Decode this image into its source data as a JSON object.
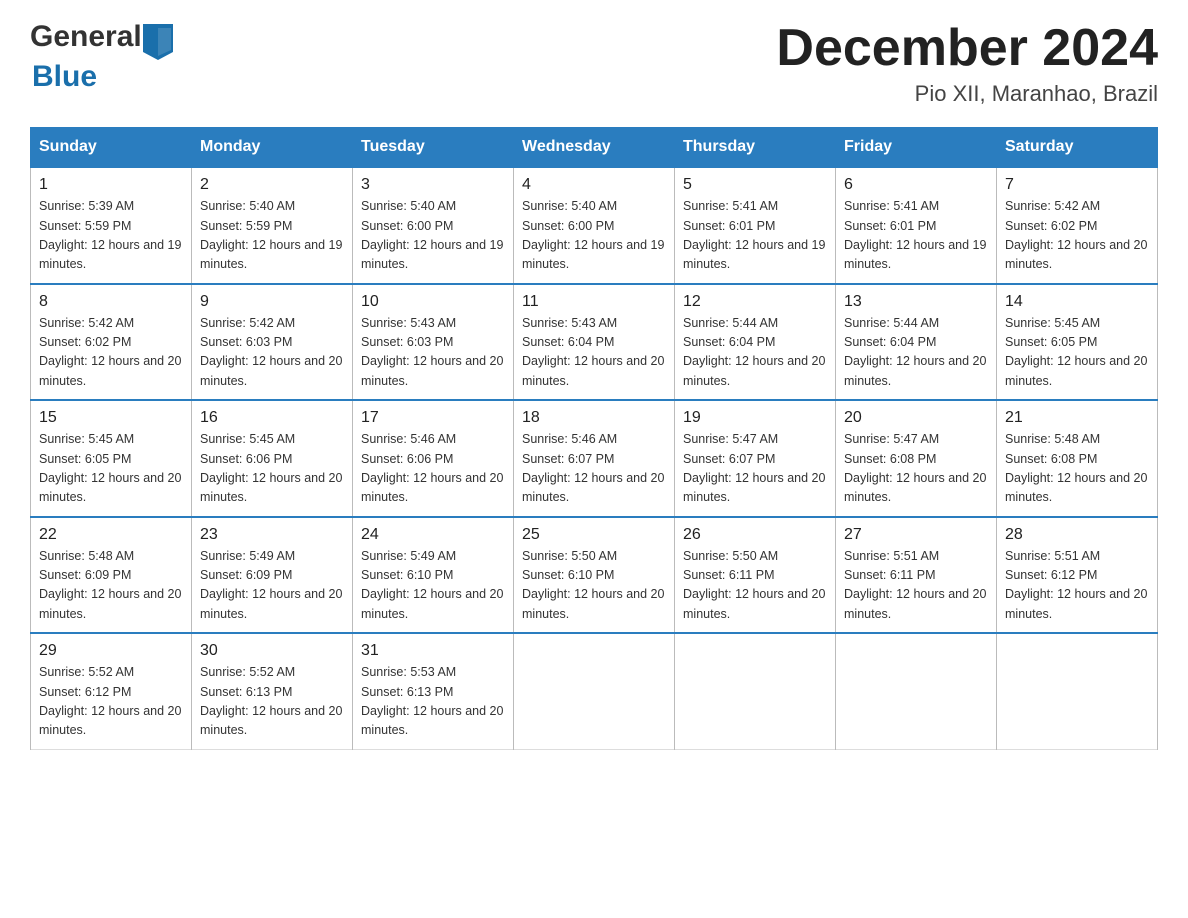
{
  "logo": {
    "general": "General",
    "blue": "Blue"
  },
  "title": "December 2024",
  "location": "Pio XII, Maranhao, Brazil",
  "headers": [
    "Sunday",
    "Monday",
    "Tuesday",
    "Wednesday",
    "Thursday",
    "Friday",
    "Saturday"
  ],
  "weeks": [
    [
      {
        "day": "1",
        "sunrise": "5:39 AM",
        "sunset": "5:59 PM",
        "daylight": "12 hours and 19 minutes."
      },
      {
        "day": "2",
        "sunrise": "5:40 AM",
        "sunset": "5:59 PM",
        "daylight": "12 hours and 19 minutes."
      },
      {
        "day": "3",
        "sunrise": "5:40 AM",
        "sunset": "6:00 PM",
        "daylight": "12 hours and 19 minutes."
      },
      {
        "day": "4",
        "sunrise": "5:40 AM",
        "sunset": "6:00 PM",
        "daylight": "12 hours and 19 minutes."
      },
      {
        "day": "5",
        "sunrise": "5:41 AM",
        "sunset": "6:01 PM",
        "daylight": "12 hours and 19 minutes."
      },
      {
        "day": "6",
        "sunrise": "5:41 AM",
        "sunset": "6:01 PM",
        "daylight": "12 hours and 19 minutes."
      },
      {
        "day": "7",
        "sunrise": "5:42 AM",
        "sunset": "6:02 PM",
        "daylight": "12 hours and 20 minutes."
      }
    ],
    [
      {
        "day": "8",
        "sunrise": "5:42 AM",
        "sunset": "6:02 PM",
        "daylight": "12 hours and 20 minutes."
      },
      {
        "day": "9",
        "sunrise": "5:42 AM",
        "sunset": "6:03 PM",
        "daylight": "12 hours and 20 minutes."
      },
      {
        "day": "10",
        "sunrise": "5:43 AM",
        "sunset": "6:03 PM",
        "daylight": "12 hours and 20 minutes."
      },
      {
        "day": "11",
        "sunrise": "5:43 AM",
        "sunset": "6:04 PM",
        "daylight": "12 hours and 20 minutes."
      },
      {
        "day": "12",
        "sunrise": "5:44 AM",
        "sunset": "6:04 PM",
        "daylight": "12 hours and 20 minutes."
      },
      {
        "day": "13",
        "sunrise": "5:44 AM",
        "sunset": "6:04 PM",
        "daylight": "12 hours and 20 minutes."
      },
      {
        "day": "14",
        "sunrise": "5:45 AM",
        "sunset": "6:05 PM",
        "daylight": "12 hours and 20 minutes."
      }
    ],
    [
      {
        "day": "15",
        "sunrise": "5:45 AM",
        "sunset": "6:05 PM",
        "daylight": "12 hours and 20 minutes."
      },
      {
        "day": "16",
        "sunrise": "5:45 AM",
        "sunset": "6:06 PM",
        "daylight": "12 hours and 20 minutes."
      },
      {
        "day": "17",
        "sunrise": "5:46 AM",
        "sunset": "6:06 PM",
        "daylight": "12 hours and 20 minutes."
      },
      {
        "day": "18",
        "sunrise": "5:46 AM",
        "sunset": "6:07 PM",
        "daylight": "12 hours and 20 minutes."
      },
      {
        "day": "19",
        "sunrise": "5:47 AM",
        "sunset": "6:07 PM",
        "daylight": "12 hours and 20 minutes."
      },
      {
        "day": "20",
        "sunrise": "5:47 AM",
        "sunset": "6:08 PM",
        "daylight": "12 hours and 20 minutes."
      },
      {
        "day": "21",
        "sunrise": "5:48 AM",
        "sunset": "6:08 PM",
        "daylight": "12 hours and 20 minutes."
      }
    ],
    [
      {
        "day": "22",
        "sunrise": "5:48 AM",
        "sunset": "6:09 PM",
        "daylight": "12 hours and 20 minutes."
      },
      {
        "day": "23",
        "sunrise": "5:49 AM",
        "sunset": "6:09 PM",
        "daylight": "12 hours and 20 minutes."
      },
      {
        "day": "24",
        "sunrise": "5:49 AM",
        "sunset": "6:10 PM",
        "daylight": "12 hours and 20 minutes."
      },
      {
        "day": "25",
        "sunrise": "5:50 AM",
        "sunset": "6:10 PM",
        "daylight": "12 hours and 20 minutes."
      },
      {
        "day": "26",
        "sunrise": "5:50 AM",
        "sunset": "6:11 PM",
        "daylight": "12 hours and 20 minutes."
      },
      {
        "day": "27",
        "sunrise": "5:51 AM",
        "sunset": "6:11 PM",
        "daylight": "12 hours and 20 minutes."
      },
      {
        "day": "28",
        "sunrise": "5:51 AM",
        "sunset": "6:12 PM",
        "daylight": "12 hours and 20 minutes."
      }
    ],
    [
      {
        "day": "29",
        "sunrise": "5:52 AM",
        "sunset": "6:12 PM",
        "daylight": "12 hours and 20 minutes."
      },
      {
        "day": "30",
        "sunrise": "5:52 AM",
        "sunset": "6:13 PM",
        "daylight": "12 hours and 20 minutes."
      },
      {
        "day": "31",
        "sunrise": "5:53 AM",
        "sunset": "6:13 PM",
        "daylight": "12 hours and 20 minutes."
      },
      null,
      null,
      null,
      null
    ]
  ]
}
